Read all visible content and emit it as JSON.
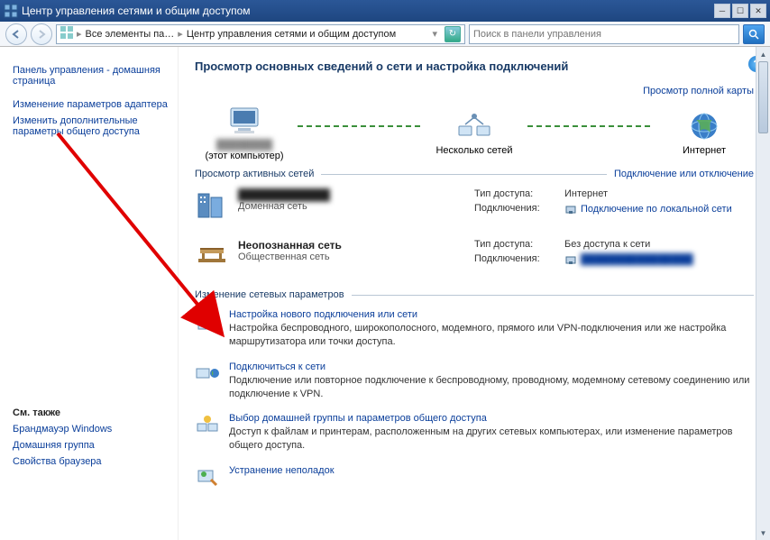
{
  "titlebar": {
    "title": "Центр управления сетями и общим доступом"
  },
  "nav": {
    "crumb1": "Все элементы па…",
    "crumb2": "Центр управления сетями и общим доступом",
    "search_placeholder": "Поиск в панели управления"
  },
  "sidebar": {
    "home": "Панель управления - домашняя страница",
    "adapter": "Изменение параметров адаптера",
    "advanced": "Изменить дополнительные параметры общего доступа",
    "see_also_hdr": "См. также",
    "see_also": {
      "firewall": "Брандмауэр Windows",
      "homegroup": "Домашняя группа",
      "browser": "Свойства браузера"
    }
  },
  "main": {
    "heading": "Просмотр основных сведений о сети и настройка подключений",
    "view_full_map": "Просмотр полной карты",
    "map": {
      "computer": "(этот компьютер)",
      "multi": "Несколько сетей",
      "internet": "Интернет"
    },
    "active_hdr": "Просмотр активных сетей",
    "connect_disconnect": "Подключение или отключение",
    "net1": {
      "name": "████████",
      "type": "Доменная сеть",
      "access_k": "Тип доступа:",
      "access_v": "Интернет",
      "conn_k": "Подключения:",
      "conn_v": "Подключение по локальной сети"
    },
    "net2": {
      "name": "Неопознанная сеть",
      "type": "Общественная сеть",
      "access_k": "Тип доступа:",
      "access_v": "Без доступа к сети",
      "conn_k": "Подключения:",
      "conn_v": "████████████"
    },
    "settings_hdr": "Изменение сетевых параметров",
    "items": {
      "setup": {
        "title": "Настройка нового подключения или сети",
        "desc": "Настройка беспроводного, широкополосного, модемного, прямого или VPN-подключения или же настройка маршрутизатора или точки доступа."
      },
      "connect": {
        "title": "Подключиться к сети",
        "desc": "Подключение или повторное подключение к беспроводному, проводному, модемному сетевому соединению или подключение к VPN."
      },
      "homegroup": {
        "title": "Выбор домашней группы и параметров общего доступа",
        "desc": "Доступ к файлам и принтерам, расположенным на других сетевых компьютерах, или изменение параметров общего доступа."
      },
      "troubleshoot": {
        "title": "Устранение неполадок"
      }
    }
  }
}
